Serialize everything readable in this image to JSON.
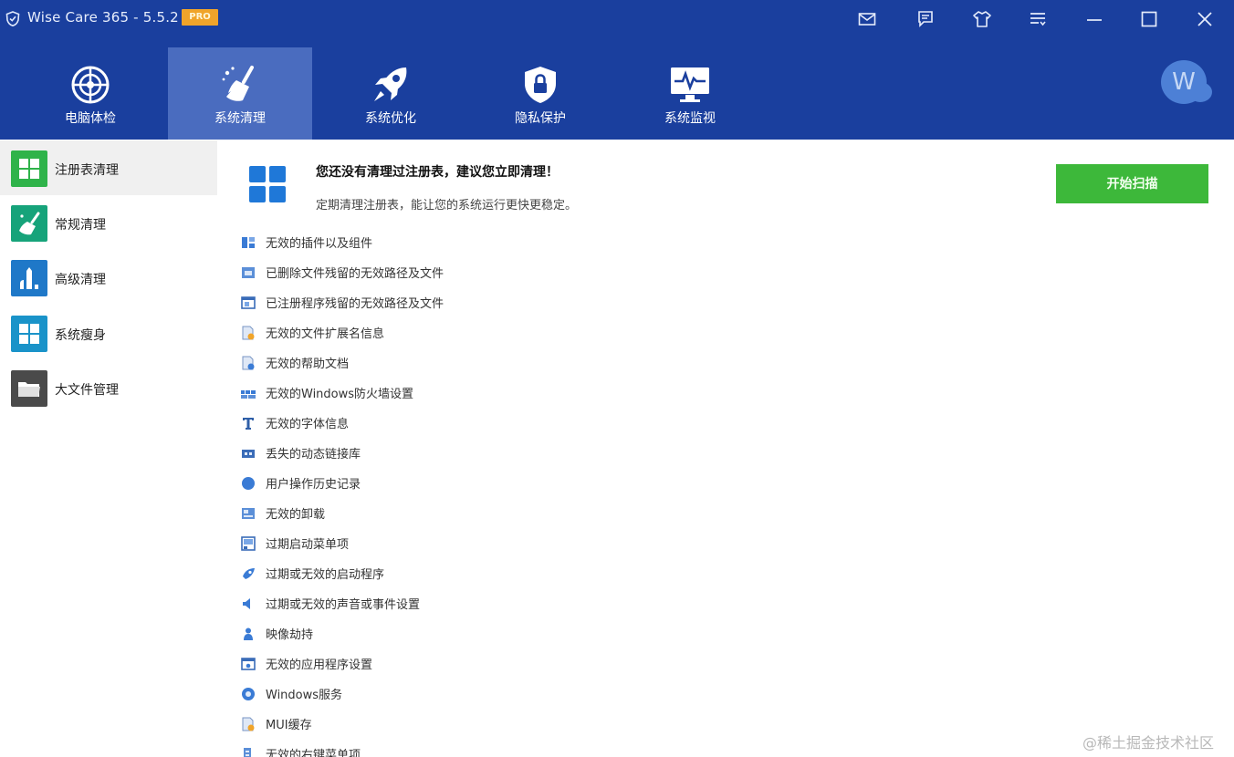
{
  "window": {
    "title": "Wise Care 365 - 5.5.2",
    "badge": "PRO",
    "controls": [
      "mail-icon",
      "feedback-icon",
      "skin-icon",
      "menu-icon",
      "minimize-icon",
      "maximize-icon",
      "close-icon"
    ]
  },
  "nav": {
    "tabs": [
      {
        "label": "电脑体检",
        "icon": "radar-icon"
      },
      {
        "label": "系统清理",
        "icon": "broom-icon",
        "active": true
      },
      {
        "label": "系统优化",
        "icon": "rocket-icon"
      },
      {
        "label": "隐私保护",
        "icon": "shield-lock-icon"
      },
      {
        "label": "系统监视",
        "icon": "monitor-pulse-icon"
      }
    ],
    "avatar_letter": "W"
  },
  "sidebar": {
    "items": [
      {
        "label": "注册表清理",
        "icon": "registry-icon",
        "color": "#2fb34a",
        "active": true
      },
      {
        "label": "常规清理",
        "icon": "broom-icon",
        "color": "#16a37a"
      },
      {
        "label": "高级清理",
        "icon": "advanced-clean-icon",
        "color": "#1f78c8"
      },
      {
        "label": "系统瘦身",
        "icon": "windows-icon",
        "color": "#1a93c9"
      },
      {
        "label": "大文件管理",
        "icon": "folder-icon",
        "color": "#4a4a4a"
      }
    ]
  },
  "main": {
    "title": "您还没有清理过注册表，建议您立即清理！",
    "subtitle": "定期清理注册表，能让您的系统运行更快更稳定。",
    "scan_button": "开始扫描",
    "accent": "#3db83a",
    "checks": [
      {
        "label": "无效的插件以及组件",
        "icon": "plugin-icon"
      },
      {
        "label": "已删除文件残留的无效路径及文件",
        "icon": "file-path-icon"
      },
      {
        "label": "已注册程序残留的无效路径及文件",
        "icon": "program-path-icon"
      },
      {
        "label": "无效的文件扩展名信息",
        "icon": "file-ext-icon"
      },
      {
        "label": "无效的帮助文档",
        "icon": "help-doc-icon"
      },
      {
        "label": "无效的Windows防火墙设置",
        "icon": "firewall-icon"
      },
      {
        "label": "无效的字体信息",
        "icon": "font-icon"
      },
      {
        "label": "丢失的动态链接库",
        "icon": "dll-icon"
      },
      {
        "label": "用户操作历史记录",
        "icon": "history-icon"
      },
      {
        "label": "无效的卸载",
        "icon": "uninstall-icon"
      },
      {
        "label": "过期启动菜单项",
        "icon": "start-menu-icon"
      },
      {
        "label": "过期或无效的启动程序",
        "icon": "startup-icon"
      },
      {
        "label": "过期或无效的声音或事件设置",
        "icon": "sound-icon"
      },
      {
        "label": "映像劫持",
        "icon": "hijack-icon"
      },
      {
        "label": "无效的应用程序设置",
        "icon": "app-settings-icon"
      },
      {
        "label": "Windows服务",
        "icon": "service-icon"
      },
      {
        "label": "MUI缓存",
        "icon": "mui-cache-icon"
      },
      {
        "label": "无效的右键菜单项",
        "icon": "context-menu-icon"
      }
    ]
  },
  "watermark": "@稀土掘金技术社区"
}
